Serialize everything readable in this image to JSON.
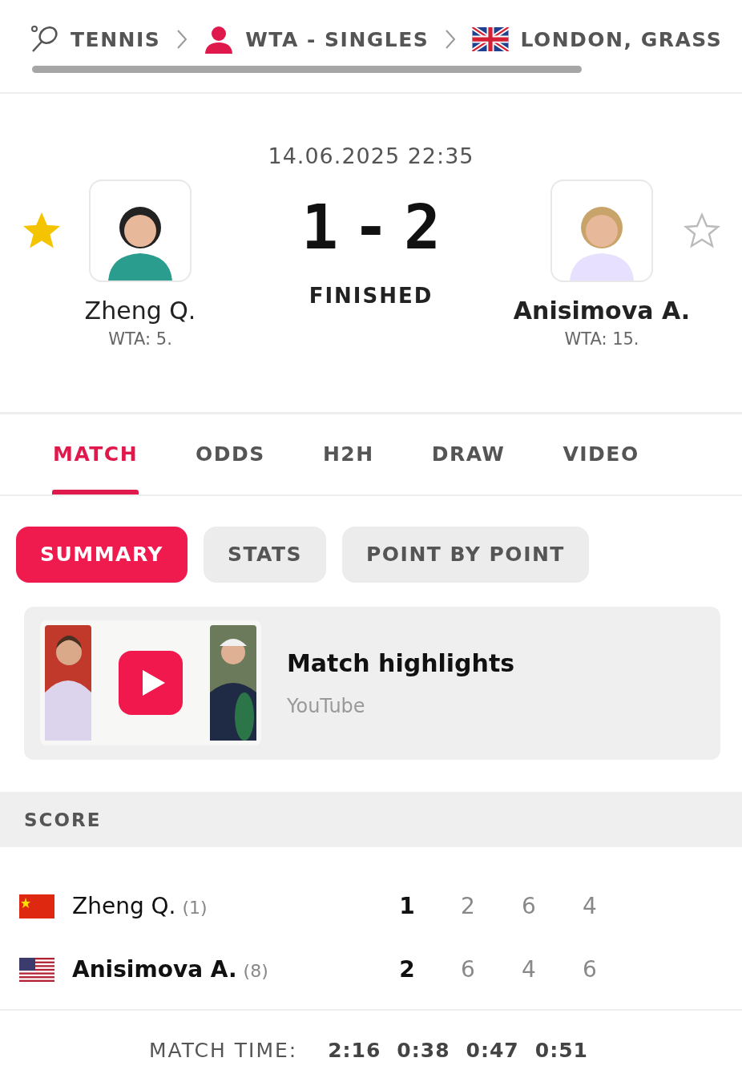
{
  "breadcrumb": [
    {
      "kind": "sport",
      "label": "TENNIS"
    },
    {
      "kind": "category",
      "label": "WTA - SINGLES"
    },
    {
      "kind": "country",
      "label": "LONDON, GRASS"
    }
  ],
  "match": {
    "datetime": "14.06.2025 22:35",
    "home": {
      "name": "Zheng Q.",
      "rank": "WTA: 5.",
      "favorite": true,
      "winner": false
    },
    "away": {
      "name": "Anisimova A.",
      "rank": "WTA: 15.",
      "favorite": false,
      "winner": true
    },
    "home_score": "1",
    "separator": "-",
    "away_score": "2",
    "status": "FINISHED"
  },
  "tabs": [
    {
      "label": "MATCH",
      "selected": true
    },
    {
      "label": "ODDS",
      "selected": false
    },
    {
      "label": "H2H",
      "selected": false
    },
    {
      "label": "DRAW",
      "selected": false
    },
    {
      "label": "VIDEO",
      "selected": false
    }
  ],
  "subtabs": [
    {
      "label": "SUMMARY",
      "selected": true
    },
    {
      "label": "STATS",
      "selected": false
    },
    {
      "label": "POINT BY POINT",
      "selected": false
    }
  ],
  "highlight": {
    "title": "Match highlights",
    "source": "YouTube"
  },
  "score": {
    "heading": "SCORE",
    "rows": [
      {
        "kind": "cn",
        "name": "Zheng Q.",
        "seed": "(1)",
        "winner": false,
        "total": "1",
        "sets": [
          "2",
          "6",
          "4"
        ]
      },
      {
        "kind": "us",
        "name": "Anisimova A.",
        "seed": "(8)",
        "winner": true,
        "total": "2",
        "sets": [
          "6",
          "4",
          "6"
        ]
      }
    ]
  },
  "match_time": {
    "label": "MATCH TIME:",
    "values": [
      "2:16",
      "0:38",
      "0:47",
      "0:51"
    ]
  }
}
